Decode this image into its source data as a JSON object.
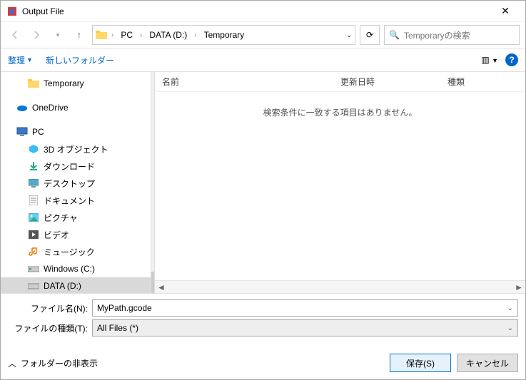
{
  "title": "Output File",
  "nav": {
    "dropdown_glyph": "▾",
    "up_glyph": "↑"
  },
  "breadcrumb": [
    "PC",
    "DATA (D:)",
    "Temporary"
  ],
  "addrbar_dropdown_glyph": "⌄",
  "refresh_glyph": "⟳",
  "search": {
    "placeholder": "Temporaryの検索",
    "icon": "🔍"
  },
  "toolbar": {
    "organize": "整理",
    "new_folder": "新しいフォルダー",
    "view_icon": "▥",
    "help": "?"
  },
  "tree": {
    "temporary": "Temporary",
    "onedrive": "OneDrive",
    "pc": "PC",
    "objects3d": "3D オブジェクト",
    "downloads": "ダウンロード",
    "desktop": "デスクトップ",
    "documents": "ドキュメント",
    "pictures": "ピクチャ",
    "videos": "ビデオ",
    "music": "ミュージック",
    "drive_c": "Windows (C:)",
    "drive_d": "DATA (D:)"
  },
  "columns": {
    "name": "名前",
    "date": "更新日時",
    "type": "種類"
  },
  "empty_message": "検索条件に一致する項目はありません。",
  "filename_label": "ファイル名(N):",
  "filename_value": "MyPath.gcode",
  "filetype_label": "ファイルの種類(T):",
  "filetype_value": "All Files (*)",
  "hide_folders": "フォルダーの非表示",
  "hide_folders_glyph": "︿",
  "save_button": "保存(S)",
  "cancel_button": "キャンセル",
  "close_glyph": "✕"
}
